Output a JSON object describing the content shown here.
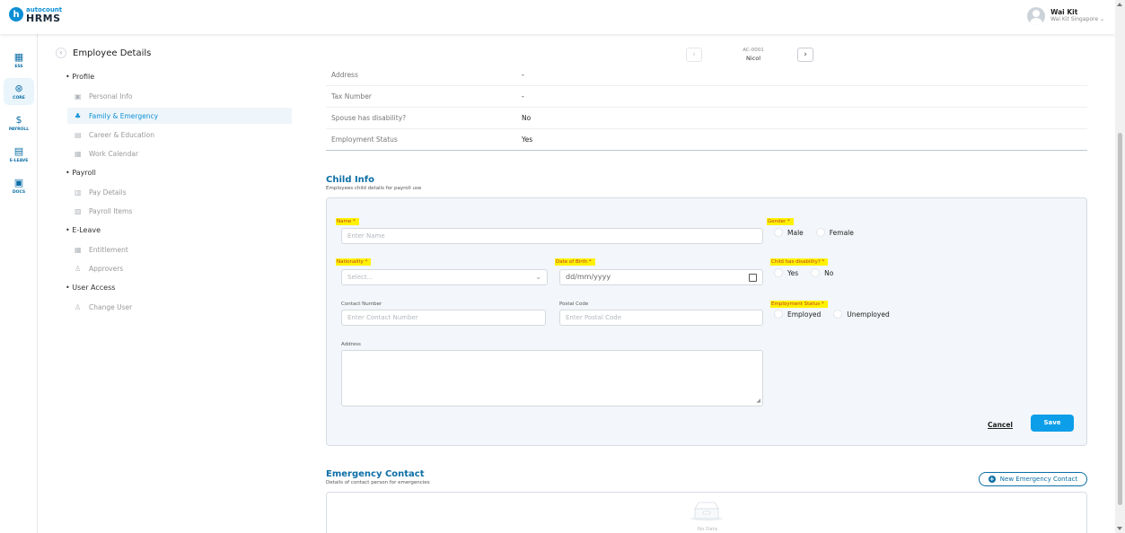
{
  "brand": {
    "small": "autocount",
    "large": "HRMS",
    "letter": "h"
  },
  "user": {
    "name": "Wai Kit",
    "company": "Wai Kit Singapore"
  },
  "rail": [
    {
      "icon": "▦",
      "label": "ESS",
      "icon_name": "ess-icon"
    },
    {
      "icon": "⊛",
      "label": "CORE",
      "icon_name": "core-icon"
    },
    {
      "icon": "$",
      "label": "PAYROLL",
      "icon_name": "payroll-icon"
    },
    {
      "icon": "▤",
      "label": "E-LEAVE",
      "icon_name": "calendar-icon"
    },
    {
      "icon": "▣",
      "label": "DOCS",
      "icon_name": "docs-icon"
    }
  ],
  "header": {
    "title": "Employee Details",
    "employee_code": "AC-0001",
    "employee_name": "Nicol"
  },
  "menu": {
    "profile": "Profile",
    "personal_info": "Personal Info",
    "family_emergency": "Family & Emergency",
    "career_education": "Career & Education",
    "work_calendar": "Work Calendar",
    "payroll": "Payroll",
    "pay_details": "Pay Details",
    "payroll_items": "Payroll Items",
    "eleave": "E-Leave",
    "entitlement": "Entitlement",
    "approvers": "Approvers",
    "user_access": "User Access",
    "change_user": "Change User"
  },
  "spouse_info": [
    {
      "label": "Address",
      "value": "-"
    },
    {
      "label": "Tax Number",
      "value": "-"
    },
    {
      "label": "Spouse has disability?",
      "value": "No"
    },
    {
      "label": "Employment Status",
      "value": "Yes"
    }
  ],
  "child_info": {
    "title": "Child Info",
    "subtitle": "Employees child details for payroll use",
    "name_label": "Name *",
    "name_placeholder": "Enter Name",
    "gender_label": "Gender *",
    "gender_male": "Male",
    "gender_female": "Female",
    "nationality_label": "Nationality *",
    "nationality_placeholder": "Select...",
    "dob_label": "Date of Birth *",
    "dob_placeholder": "dd/mm/yyyy",
    "disability_label": "Child has disability? *",
    "disability_yes": "Yes",
    "disability_no": "No",
    "contact_label": "Contact Number",
    "contact_placeholder": "Enter Contact Number",
    "postal_label": "Postal Code",
    "postal_placeholder": "Enter Postal Code",
    "employment_label": "Employment Status *",
    "employment_employed": "Employed",
    "employment_unemployed": "Unemployed",
    "address_label": "Address",
    "cancel": "Cancel",
    "save": "Save"
  },
  "emergency": {
    "title": "Emergency Contact",
    "subtitle": "Details of contact person for emergencies",
    "new_button": "New Emergency Contact",
    "empty_text": "No Data"
  },
  "colors": {
    "accent": "#0c8fd6",
    "highlight": "#fff200",
    "required": "#c0392b"
  }
}
